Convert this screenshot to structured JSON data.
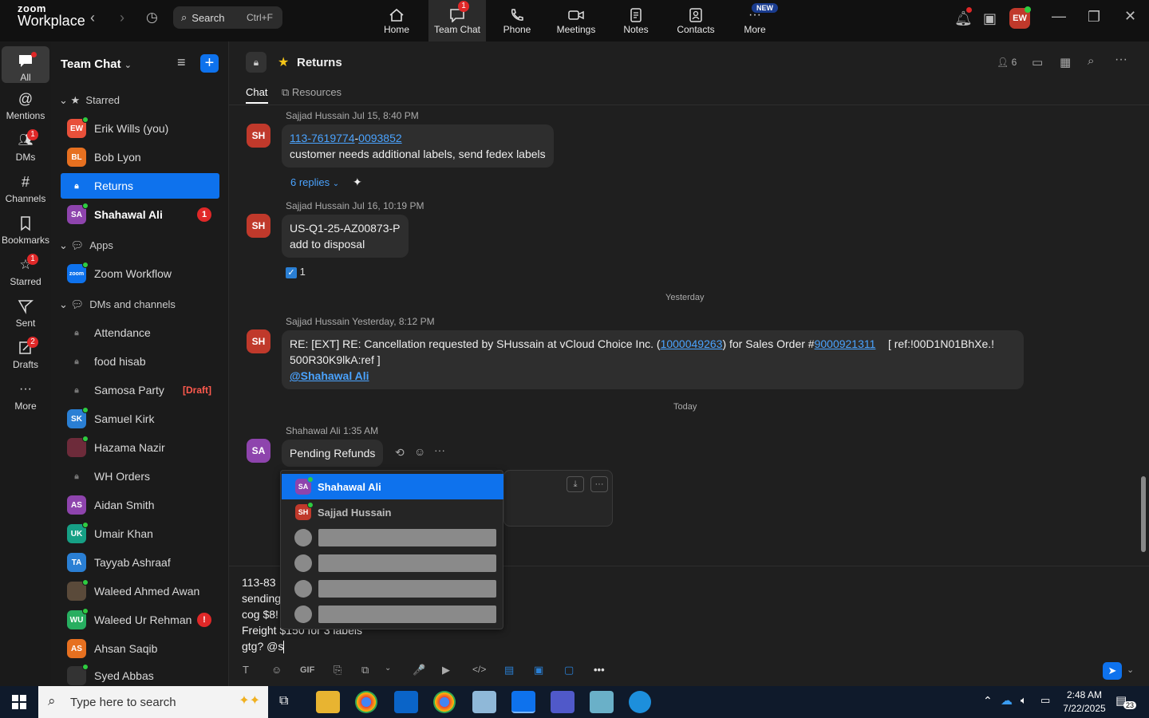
{
  "app": {
    "logo_line1": "zoom",
    "logo_line2": "Workplace",
    "search_label": "Search",
    "search_shortcut": "Ctrl+F",
    "nav": [
      {
        "label": "Home",
        "icon": "home-icon"
      },
      {
        "label": "Team Chat",
        "icon": "chat-icon",
        "badge": "1"
      },
      {
        "label": "Phone",
        "icon": "phone-icon"
      },
      {
        "label": "Meetings",
        "icon": "video-icon"
      },
      {
        "label": "Notes",
        "icon": "notes-icon"
      },
      {
        "label": "Contacts",
        "icon": "contacts-icon"
      },
      {
        "label": "More",
        "icon": "more-icon",
        "badge": "NEW"
      }
    ],
    "user_initials": "EW"
  },
  "rail": [
    {
      "label": "All"
    },
    {
      "label": "Mentions"
    },
    {
      "label": "DMs",
      "badge": "1"
    },
    {
      "label": "Channels"
    },
    {
      "label": "Bookmarks"
    },
    {
      "label": "Starred",
      "badge": "1"
    },
    {
      "label": "Sent"
    },
    {
      "label": "Drafts",
      "badge": "2"
    },
    {
      "label": "More"
    }
  ],
  "sidebar": {
    "title": "Team Chat",
    "sections": {
      "starred": "Starred",
      "apps": "Apps",
      "dms": "DMs and channels"
    },
    "starred_items": [
      {
        "initials": "EW",
        "label": "Erik Wills (you)",
        "color": "#e8503a"
      },
      {
        "initials": "BL",
        "label": "Bob Lyon",
        "color": "#e67020"
      },
      {
        "initials": "",
        "label": "Returns",
        "selected": true
      },
      {
        "initials": "SA",
        "label": "Shahawal Ali",
        "color": "#8e44ad",
        "badge": "1"
      }
    ],
    "app_items": [
      {
        "initials": "zoom",
        "label": "Zoom Workflow",
        "color": "#0e72ed"
      }
    ],
    "dm_items": [
      {
        "initials": "",
        "label": "Attendance"
      },
      {
        "initials": "",
        "label": "food hisab"
      },
      {
        "initials": "",
        "label": "Samosa Party",
        "draft": "[Draft]"
      },
      {
        "initials": "SK",
        "label": "Samuel Kirk",
        "color": "#2a7fd4"
      },
      {
        "initials": "",
        "label": "Hazama Nazir",
        "color": "#6d2b3a"
      },
      {
        "initials": "",
        "label": "WH Orders"
      },
      {
        "initials": "AS",
        "label": "Aidan Smith",
        "color": "#8e44ad"
      },
      {
        "initials": "UK",
        "label": "Umair Khan",
        "color": "#16a085"
      },
      {
        "initials": "TA",
        "label": "Tayyab Ashraaf",
        "color": "#2a7fd4"
      },
      {
        "initials": "",
        "label": "Waleed Ahmed Awan",
        "color": "#5a4a3a"
      },
      {
        "initials": "WU",
        "label": "Waleed Ur Rehman",
        "color": "#27ae60",
        "alert": "!"
      },
      {
        "initials": "AS",
        "label": "Ahsan Saqib",
        "color": "#e67020"
      },
      {
        "initials": "",
        "label": "Syed Abbas",
        "color": "#333"
      }
    ]
  },
  "channel": {
    "name": "Returns",
    "member_count": "6",
    "tabs": [
      "Chat",
      "Resources"
    ]
  },
  "messages": [
    {
      "initials": "SH",
      "sender": "Sajjad Hussain",
      "time": "Jul 15, 8:40 PM",
      "link1": "113-7619774",
      "sep": "-",
      "link2": "0093852",
      "text": "customer needs additional labels, send fedex labels",
      "replies": "6 replies"
    },
    {
      "initials": "SH",
      "sender": "Sajjad Hussain",
      "time": "Jul 16, 10:19 PM",
      "line1": "US-Q1-25-AZ00873-P",
      "line2": "add to disposal",
      "reaction_count": "1"
    },
    {
      "initials": "SH",
      "sender": "Sajjad Hussain",
      "time": "Yesterday, 8:12 PM",
      "pre": "RE: [EXT] RE: Cancellation requested by SHussain at vCloud Choice Inc. (",
      "link1": "1000049263",
      "mid": ") for Sales Order #",
      "link2": "9000921311",
      "post": "    [ ref:!00D1N01BhXe.!",
      "line2": "500R30K9lkA:ref ]",
      "mention": "@Shahawal Ali"
    },
    {
      "initials": "SA",
      "sender": "Shahawal Ali",
      "time": "1:35 AM",
      "text": "Pending Refunds"
    }
  ],
  "day_separators": [
    "Yesterday",
    "Today"
  ],
  "composer": {
    "lines": [
      "113-83",
      "sending",
      "cog $8!",
      "Freight $150 for 3 labels",
      "gtg? @s"
    ],
    "toolbar": [
      "T",
      "☺",
      "GIF",
      "⎘",
      "⧉",
      "🎤",
      "▶",
      "</>",
      "▤",
      "▣",
      "▢",
      "•••"
    ]
  },
  "mention_popup": {
    "options": [
      {
        "initials": "SA",
        "name": "Shahawal Ali",
        "color": "#8e44ad",
        "selected": true
      },
      {
        "initials": "SH",
        "name": "Sajjad Hussain",
        "color": "#c0392b"
      }
    ]
  },
  "taskbar": {
    "search_placeholder": "Type here to search",
    "time": "2:48 AM",
    "date": "7/22/2025",
    "notif_count": "23"
  }
}
